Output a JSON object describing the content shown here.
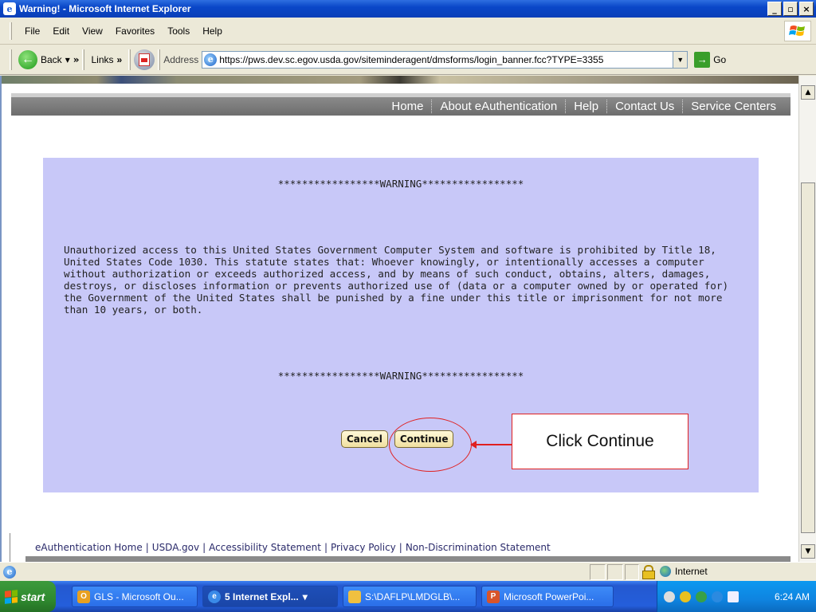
{
  "window": {
    "title": "Warning! - Microsoft Internet Explorer",
    "controls": [
      "_",
      "▫",
      "×"
    ]
  },
  "menu": [
    "File",
    "Edit",
    "View",
    "Favorites",
    "Tools",
    "Help"
  ],
  "toolbar": {
    "back_label": "Back",
    "links_label": "Links",
    "address_label": "Address",
    "address_value": "https://pws.dev.sc.egov.usda.gov/siteminderagent/dmsforms/login_banner.fcc?TYPE=3355",
    "go_label": "Go"
  },
  "nav": [
    "Home",
    "About eAuthentication",
    "Help",
    "Contact Us",
    "Service Centers"
  ],
  "warning": {
    "header": "*****************WARNING*****************",
    "body": "Unauthorized access to this United States Government Computer System and software is prohibited by Title 18, United States Code 1030. This statute states that: Whoever knowingly, or intentionally accesses a computer without authorization or exceeds authorized access, and by means of such conduct, obtains, alters, damages, destroys, or discloses information or prevents authorized use of (data or a computer owned by or operated for) the Government of the United States shall be punished by a fine under this title or imprisonment for not more than 10 years, or both.",
    "footer": "*****************WARNING*****************",
    "cancel_label": "Cancel",
    "continue_label": "Continue"
  },
  "annotation": {
    "callout_text": "Click Continue",
    "color": "#e02020"
  },
  "footer_links": [
    "eAuthentication Home",
    "USDA.gov",
    "Accessibility Statement",
    "Privacy Policy",
    "Non-Discrimination Statement"
  ],
  "status": {
    "zone": "Internet"
  },
  "taskbar": {
    "start_label": "start",
    "tasks": [
      "GLS - Microsoft Ou...",
      "5 Internet Expl...",
      "S:\\DAFLP\\LMDGLB\\...",
      "Microsoft PowerPoi..."
    ],
    "clock": "6:24 AM"
  },
  "colors": {
    "panel_bg": "#c8c8f8",
    "navbar_bg": "#6d6d6d",
    "button_bg": "#f0e0a0"
  }
}
